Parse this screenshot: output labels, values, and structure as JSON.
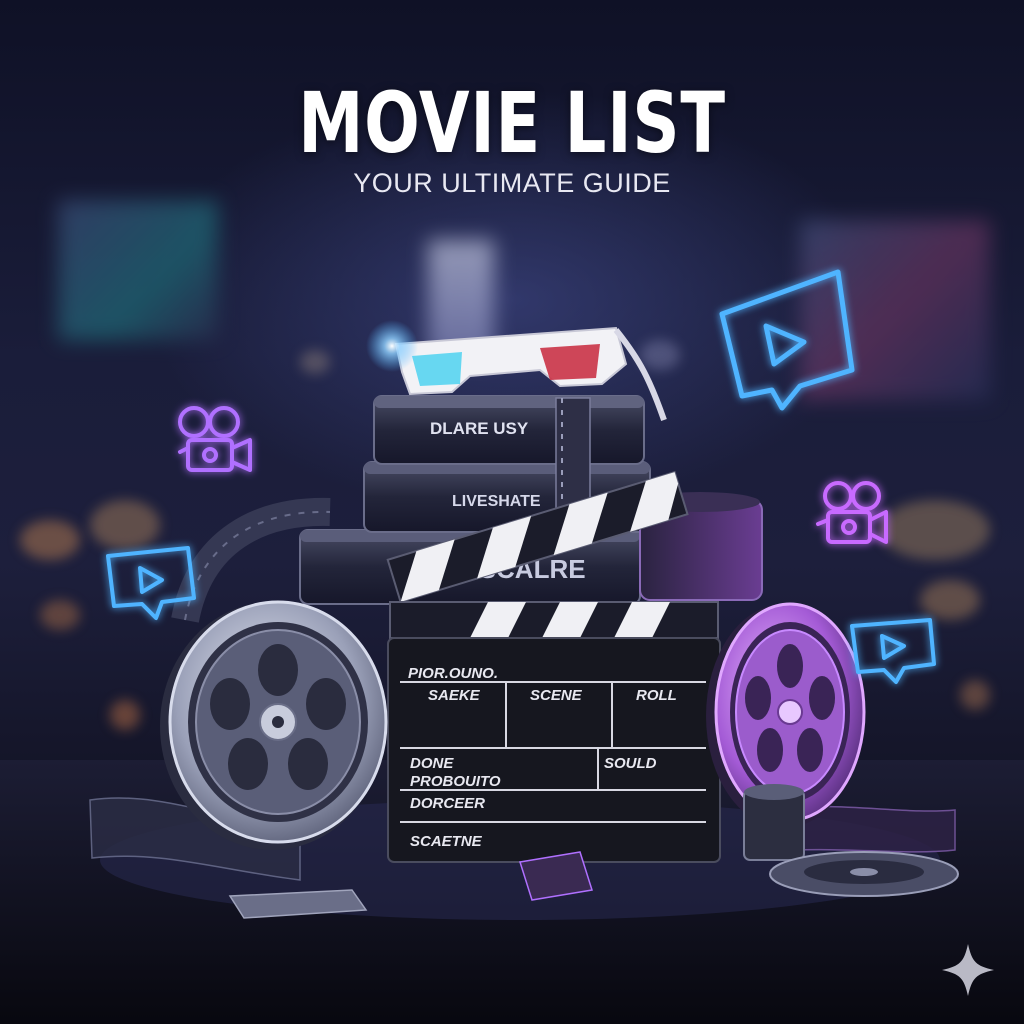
{
  "poster": {
    "title": "MOVIE LIST",
    "subtitle": "YOUR ULTIMATE GUIDE"
  },
  "cans": {
    "top_label": "DLARE USY",
    "middle_label": "LIVESHATE",
    "bottom_label": "CAISE SCALRE"
  },
  "clapperboard": {
    "header": "PIOR.OUNO.",
    "col_1": "SAEKE",
    "col_2": "SCENE",
    "col_3": "ROLL",
    "row_done": "DONE",
    "row_sould": "SOULD",
    "row_producer": "PROBOUITO",
    "row_director": "DORCEER",
    "row_scene": "SCAETNE"
  },
  "icons": [
    "movie-camera-icon",
    "play-screen-icon",
    "3d-glasses-icon",
    "film-reel-icon",
    "clapperboard-icon",
    "sparkle-icon"
  ],
  "colors": {
    "neon_blue": "#4fb4ff",
    "neon_purple": "#b070ff",
    "neon_violet": "#c86bff",
    "background": "#141528"
  }
}
